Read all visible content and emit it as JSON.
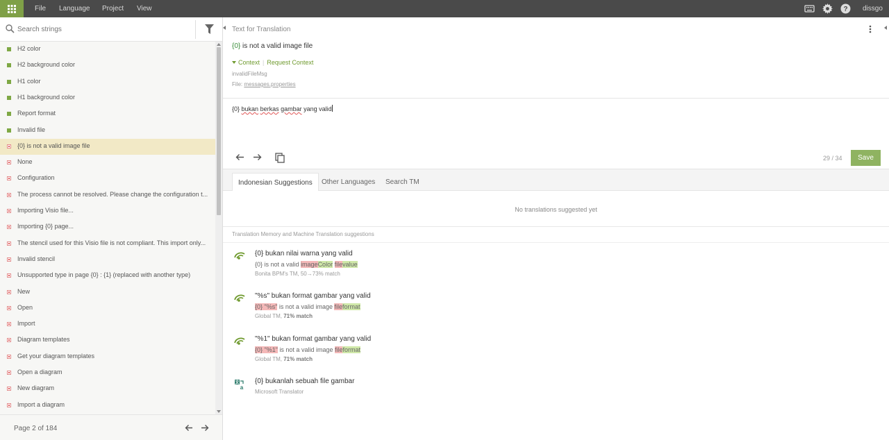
{
  "menu": [
    "File",
    "Language",
    "Project",
    "View"
  ],
  "user": "dissgo",
  "search": {
    "placeholder": "Search strings"
  },
  "strings": [
    {
      "label": "H2 color",
      "status": "ok"
    },
    {
      "label": "H2 background color",
      "status": "ok"
    },
    {
      "label": "H1 color",
      "status": "ok"
    },
    {
      "label": "H1 background color",
      "status": "ok"
    },
    {
      "label": "Report format",
      "status": "ok"
    },
    {
      "label": "Invalid file",
      "status": "ok"
    },
    {
      "label": "{0} is not a valid image file",
      "status": "bad",
      "selected": true
    },
    {
      "label": "None",
      "status": "bad"
    },
    {
      "label": "Configuration",
      "status": "bad"
    },
    {
      "label": "The process cannot be resolved. Please change the configuration t...",
      "status": "bad"
    },
    {
      "label": "Importing Visio file...",
      "status": "bad"
    },
    {
      "label": "Importing {0} page...",
      "status": "bad"
    },
    {
      "label": "The stencil used for this Visio file is not compliant. This import only...",
      "status": "bad"
    },
    {
      "label": "Invalid stencil",
      "status": "bad"
    },
    {
      "label": "Unsupported type in page {0} : {1} (replaced with another type)",
      "status": "bad"
    },
    {
      "label": "New",
      "status": "bad"
    },
    {
      "label": "Open",
      "status": "bad"
    },
    {
      "label": "Import",
      "status": "bad"
    },
    {
      "label": "Diagram templates",
      "status": "bad"
    },
    {
      "label": "Get your diagram templates",
      "status": "bad"
    },
    {
      "label": "Open a diagram",
      "status": "bad"
    },
    {
      "label": "New diagram",
      "status": "bad"
    },
    {
      "label": "Import a diagram",
      "status": "bad"
    }
  ],
  "pager": {
    "text": "Page 2 of 184"
  },
  "source": {
    "heading": "Text for Translation",
    "placeholder": "{0}",
    "text_rest": " is not a valid image file",
    "context_label": "Context",
    "request_context_label": "Request Context",
    "key": "invalidFileMsg",
    "file_prefix": "File: ",
    "file_name": "messages.properties"
  },
  "translation": {
    "pre": "{0} ",
    "w1": "bukan",
    "w2": "berkas",
    "w3": "gambar",
    "post": " yang valid"
  },
  "counter": "29 / 34",
  "save_label": "Save",
  "tabs": [
    "Indonesian Suggestions",
    "Other Languages",
    "Search TM"
  ],
  "no_suggestions": "No translations suggested yet",
  "tm_heading": "Translation Memory and Machine Translation suggestions",
  "suggestions": [
    {
      "text": "{0} bukan nilai warna yang valid",
      "src_a": "{0} is not a valid ",
      "src_del1": "image",
      "src_ins1": "Color",
      "src_space": " ",
      "src_del2": "file",
      "src_ins2": "value",
      "meta": "Bonita BPM's TM, 50→73% match",
      "icon": "tm-icon"
    },
    {
      "text": "\"%s\" bukan format gambar yang valid",
      "src_del0": "{0} \"%s\"",
      "src_mid": " is not a valid image ",
      "src_del2": "file",
      "src_ins2": "format",
      "meta_source": "Global TM, ",
      "meta_match": "71% match",
      "icon": "tm-icon"
    },
    {
      "text": "\"%1\" bukan format gambar yang valid",
      "src_del0": "{0} \"%1\"",
      "src_mid": " is not a valid image ",
      "src_del2": "file",
      "src_ins2": "format",
      "meta_source": "Global TM, ",
      "meta_match": "71% match",
      "icon": "tm-icon"
    },
    {
      "text": "{0} bukanlah sebuah file gambar",
      "meta": "Microsoft Translator",
      "icon": "microsoft-translator-icon"
    }
  ]
}
